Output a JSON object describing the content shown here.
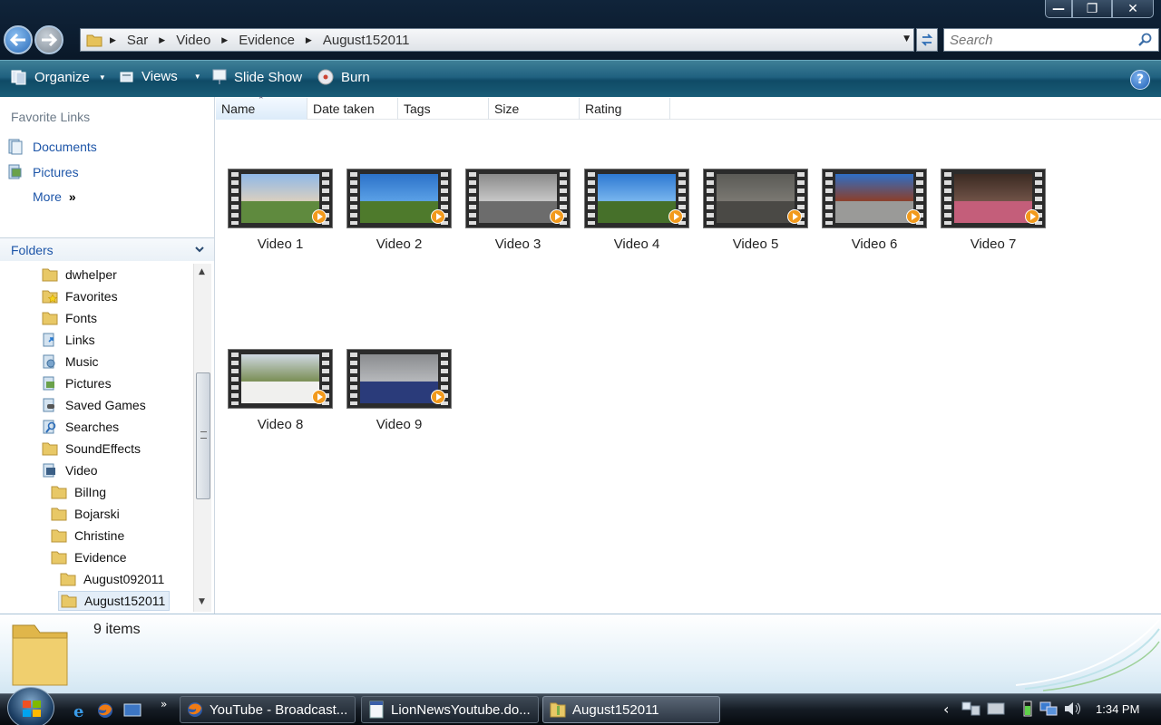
{
  "address": {
    "breadcrumb": [
      "Sar",
      "Video",
      "Evidence",
      "August152011"
    ]
  },
  "search": {
    "placeholder": "Search"
  },
  "toolbar": {
    "organize": "Organize",
    "views": "Views",
    "slideshow": "Slide Show",
    "burn": "Burn"
  },
  "favorites": {
    "title": "Favorite Links",
    "items": [
      "Documents",
      "Pictures",
      "More"
    ]
  },
  "folders": {
    "title": "Folders",
    "tree": [
      {
        "label": "dwhelper",
        "icon": "folder-icon"
      },
      {
        "label": "Favorites",
        "icon": "favorites-folder-icon"
      },
      {
        "label": "Fonts",
        "icon": "folder-icon"
      },
      {
        "label": "Links",
        "icon": "links-folder-icon"
      },
      {
        "label": "Music",
        "icon": "music-folder-icon"
      },
      {
        "label": "Pictures",
        "icon": "pictures-folder-icon"
      },
      {
        "label": "Saved Games",
        "icon": "saved-games-folder-icon"
      },
      {
        "label": "Searches",
        "icon": "searches-folder-icon"
      },
      {
        "label": "SoundEffects",
        "icon": "folder-icon"
      },
      {
        "label": "Video",
        "icon": "video-folder-icon"
      },
      {
        "label": "BilIng",
        "icon": "folder-icon"
      },
      {
        "label": "Bojarski",
        "icon": "folder-icon"
      },
      {
        "label": "Christine",
        "icon": "folder-icon"
      },
      {
        "label": "Evidence",
        "icon": "folder-icon"
      },
      {
        "label": "August092011",
        "icon": "folder-icon"
      },
      {
        "label": "August152011",
        "icon": "folder-icon",
        "selected": true
      }
    ]
  },
  "columns": [
    "Name",
    "Date taken",
    "Tags",
    "Size",
    "Rating"
  ],
  "files": [
    {
      "label": "Video 1",
      "colors": [
        "#8fb8e8",
        "#d9cfc0",
        "#5f8a3e"
      ]
    },
    {
      "label": "Video 2",
      "colors": [
        "#2c72c8",
        "#5aa0e6",
        "#4e7a2c"
      ]
    },
    {
      "label": "Video 3",
      "colors": [
        "#8a8a8a",
        "#c7c7c7",
        "#6c6c6c"
      ]
    },
    {
      "label": "Video 4",
      "colors": [
        "#2e79d2",
        "#77b4ee",
        "#46702a"
      ]
    },
    {
      "label": "Video 5",
      "colors": [
        "#5b5a56",
        "#7a7872",
        "#4a4945"
      ]
    },
    {
      "label": "Video 6",
      "colors": [
        "#2f6fc6",
        "#8b3f2b",
        "#9a9a98"
      ]
    },
    {
      "label": "Video 7",
      "colors": [
        "#3b2a22",
        "#6f5247",
        "#c45e7a"
      ]
    },
    {
      "label": "Video 8",
      "colors": [
        "#cfd8e2",
        "#7a8e55",
        "#f0f0ee"
      ]
    },
    {
      "label": "Video 9",
      "colors": [
        "#8a8c8f",
        "#b6b8bb",
        "#2a3b7a"
      ]
    }
  ],
  "status": {
    "count": "9 items"
  },
  "taskbar": {
    "tasks": [
      "YouTube - Broadcast...",
      "LionNewsYoutube.do...",
      "August152011"
    ],
    "more": "»",
    "clock": "1:34 PM"
  }
}
